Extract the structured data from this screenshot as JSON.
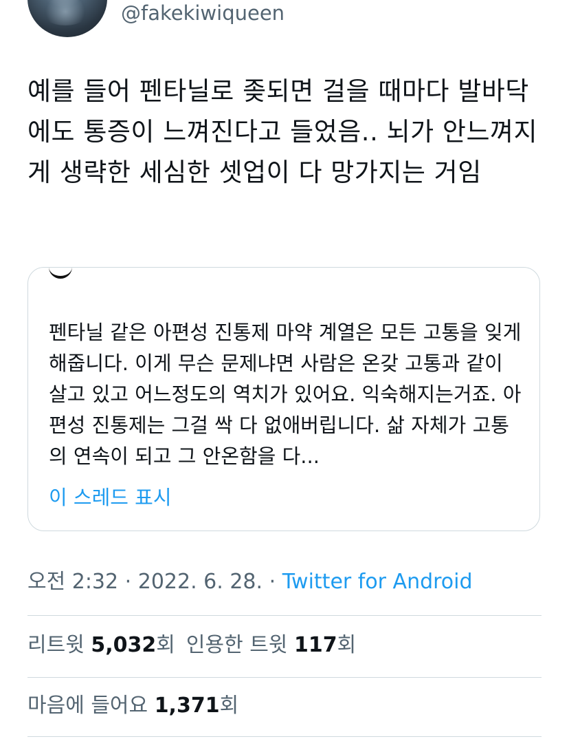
{
  "tweet": {
    "handle": "@fakekiwiqueen",
    "text": "예를 들어 펜타닐로 좆되면 걸을 때마다 발바닥에도 통증이 느껴진다고 들었음.. 뇌가 안느껴지게 생략한 세심한 셋업이 다 망가지는 거임"
  },
  "quote": {
    "text": "펜타닐 같은 아편성 진통제 마약 계열은 모든 고통을 잊게 해줍니다. 이게 무슨 문제냐면 사람은 온갖 고통과 같이 살고 있고 어느정도의 역치가 있어요. 익숙해지는거죠. 아편성 진통제는 그걸 싹 다 없애버립니다. 삶 자체가 고통의 연속이 되고 그 안온함을 다...",
    "show_thread": "이 스레드 표시"
  },
  "meta": {
    "time": "오전 2:32",
    "separator": "·",
    "date": "2022. 6. 28.",
    "source": "Twitter for Android"
  },
  "stats": {
    "retweets_label": "리트윗",
    "retweets_count": "5,032",
    "count_suffix": "회",
    "quotes_label": "인용한 트윗",
    "quotes_count": "117",
    "likes_label": "마음에 들어요",
    "likes_count": "1,371"
  },
  "colors": {
    "link": "#1d9bf0",
    "secondary_text": "#536471",
    "border": "#cfd9de"
  }
}
